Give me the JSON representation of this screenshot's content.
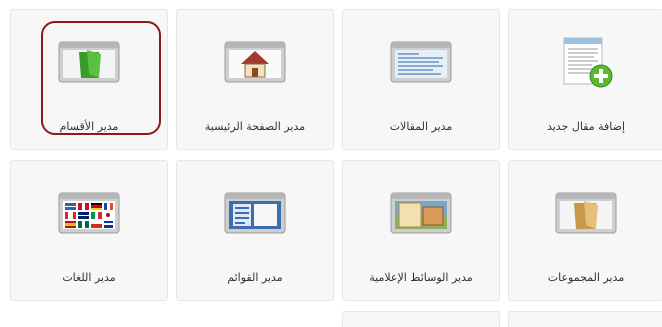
{
  "tiles": [
    {
      "label": "إضافة مقال جديد",
      "icon": "add-article-icon"
    },
    {
      "label": "مدير المقالات",
      "icon": "articles-icon"
    },
    {
      "label": "مدير الصفحة الرئيسية",
      "icon": "home-icon"
    },
    {
      "label": "مدير الأقسام",
      "icon": "green-folder-icon",
      "selected": true
    },
    {
      "label": "مدير المجموعات",
      "icon": "folder-icon"
    },
    {
      "label": "مدير الوسائط الإعلامية",
      "icon": "media-icon"
    },
    {
      "label": "مدير القوائم",
      "icon": "menus-icon"
    },
    {
      "label": "مدير اللغات",
      "icon": "flags-icon"
    }
  ],
  "colors": {
    "selected_ring": "#8b1a1a",
    "tile_bg": "#f7f7f7",
    "tile_border": "#e7e7e7"
  }
}
